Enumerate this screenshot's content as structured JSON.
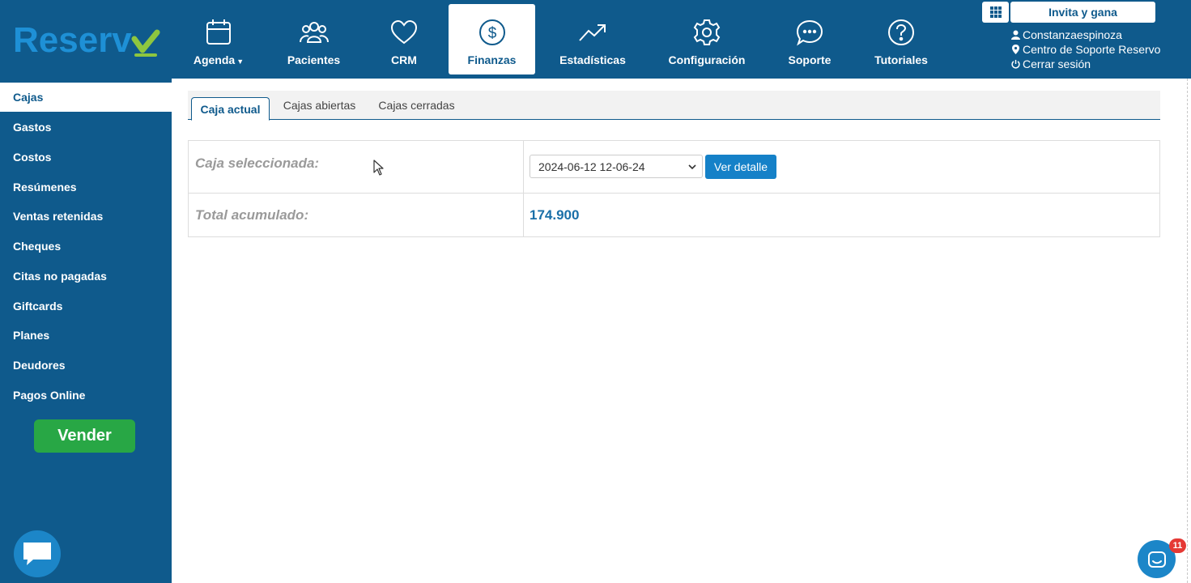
{
  "brand": {
    "logo_text": "Reservo",
    "primary_color": "#0f5a8c",
    "accent_green": "#8dc63f"
  },
  "nav": {
    "items": [
      {
        "label": "Agenda",
        "icon": "calendar-icon",
        "has_dropdown": true,
        "active": false
      },
      {
        "label": "Pacientes",
        "icon": "users-icon",
        "active": false
      },
      {
        "label": "CRM",
        "icon": "heart-icon",
        "active": false
      },
      {
        "label": "Finanzas",
        "icon": "dollar-circle-icon",
        "active": true
      },
      {
        "label": "Estadísticas",
        "icon": "trending-up-icon",
        "active": false
      },
      {
        "label": "Configuración",
        "icon": "gear-icon",
        "active": false
      },
      {
        "label": "Soporte",
        "icon": "chat-bubble-icon",
        "active": false
      },
      {
        "label": "Tutoriales",
        "icon": "question-circle-icon",
        "active": false
      }
    ]
  },
  "header_right": {
    "apps_icon": "grid-icon",
    "invite_label": "Invita y gana",
    "username": "Constanzaespinoza",
    "support_center": "Centro de Soporte Reservo",
    "logout": "Cerrar sesión"
  },
  "sidebar": {
    "items": [
      {
        "label": "Cajas",
        "active": true
      },
      {
        "label": "Gastos"
      },
      {
        "label": "Costos"
      },
      {
        "label": "Resúmenes"
      },
      {
        "label": "Ventas retenidas"
      },
      {
        "label": "Cheques"
      },
      {
        "label": "Citas no pagadas"
      },
      {
        "label": "Giftcards"
      },
      {
        "label": "Planes"
      },
      {
        "label": "Deudores"
      },
      {
        "label": "Pagos Online"
      }
    ],
    "sell_button": "Vender",
    "sell_color": "#28a745"
  },
  "tabs": [
    {
      "label": "Caja actual",
      "active": true
    },
    {
      "label": "Cajas abiertas",
      "active": false
    },
    {
      "label": "Cajas cerradas",
      "active": false
    }
  ],
  "caja": {
    "selected_label": "Caja seleccionada:",
    "selected_value": "2024-06-12 12-06-24",
    "detail_button": "Ver detalle",
    "total_label": "Total acumulado:",
    "total_value": "174.900"
  },
  "messenger": {
    "badge_count": "11"
  }
}
